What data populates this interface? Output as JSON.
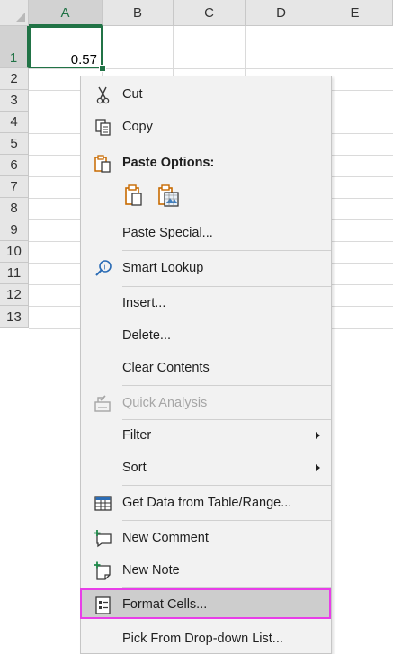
{
  "sheet": {
    "columns": [
      "A",
      "B",
      "C",
      "D",
      "E"
    ],
    "rows": [
      "1",
      "2",
      "3",
      "4",
      "5",
      "6",
      "7",
      "8",
      "9",
      "10",
      "11",
      "12",
      "13"
    ],
    "cell_a1_value": "0.57",
    "accent_color": "#217346"
  },
  "menu": {
    "cut": "Cut",
    "copy": "Copy",
    "paste_options": "Paste Options:",
    "paste_special": "Paste Special...",
    "smart_lookup": "Smart Lookup",
    "insert": "Insert...",
    "delete": "Delete...",
    "clear_contents": "Clear Contents",
    "quick_analysis": "Quick Analysis",
    "filter": "Filter",
    "sort": "Sort",
    "get_data": "Get Data from Table/Range...",
    "new_comment": "New Comment",
    "new_note": "New Note",
    "format_cells": "Format Cells...",
    "pick_from_list": "Pick From Drop-down List...",
    "highlight_color": "#e83ee8",
    "icons": [
      "scissors-icon",
      "copy-icon",
      "paste-icon",
      "paste-keep-icon",
      "paste-picture-icon",
      "smart-lookup-icon",
      "quick-analysis-icon",
      "get-data-icon",
      "new-comment-icon",
      "new-note-icon",
      "format-cells-icon"
    ]
  }
}
